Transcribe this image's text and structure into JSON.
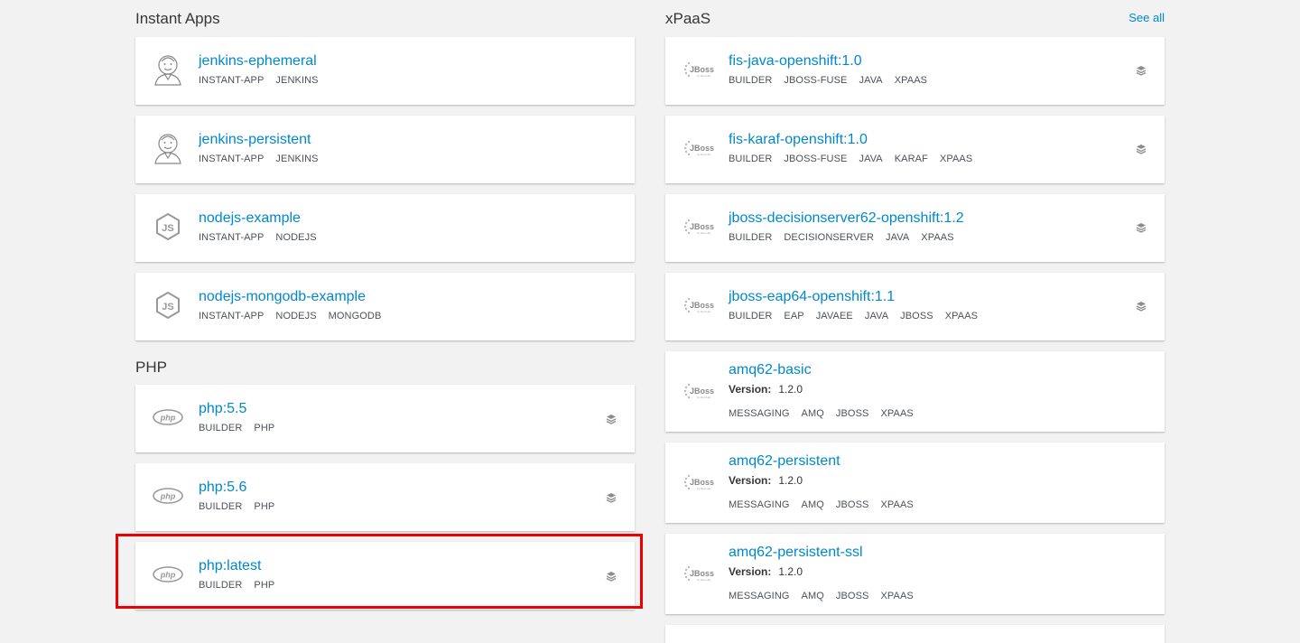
{
  "instant_apps": {
    "title": "Instant Apps",
    "items": [
      {
        "name": "jenkins-ephemeral",
        "icon": "jenkins-icon",
        "tags": [
          "INSTANT-APP",
          "JENKINS"
        ]
      },
      {
        "name": "jenkins-persistent",
        "icon": "jenkins-icon",
        "tags": [
          "INSTANT-APP",
          "JENKINS"
        ]
      },
      {
        "name": "nodejs-example",
        "icon": "nodejs-icon",
        "tags": [
          "INSTANT-APP",
          "NODEJS"
        ]
      },
      {
        "name": "nodejs-mongodb-example",
        "icon": "nodejs-icon",
        "tags": [
          "INSTANT-APP",
          "NODEJS",
          "MONGODB"
        ]
      }
    ]
  },
  "php": {
    "title": "PHP",
    "items": [
      {
        "name": "php:5.5",
        "icon": "php-icon",
        "tags": [
          "BUILDER",
          "PHP"
        ]
      },
      {
        "name": "php:5.6",
        "icon": "php-icon",
        "tags": [
          "BUILDER",
          "PHP"
        ]
      },
      {
        "name": "php:latest",
        "icon": "php-icon",
        "tags": [
          "BUILDER",
          "PHP"
        ]
      }
    ]
  },
  "xpaas": {
    "title": "xPaaS",
    "see_all": "See all",
    "items": [
      {
        "name": "fis-java-openshift:1.0",
        "tags": [
          "BUILDER",
          "JBOSS-FUSE",
          "JAVA",
          "XPAAS"
        ]
      },
      {
        "name": "fis-karaf-openshift:1.0",
        "tags": [
          "BUILDER",
          "JBOSS-FUSE",
          "JAVA",
          "KARAF",
          "XPAAS"
        ]
      },
      {
        "name": "jboss-decisionserver62-openshift:1.2",
        "tags": [
          "BUILDER",
          "DECISIONSERVER",
          "JAVA",
          "XPAAS"
        ]
      },
      {
        "name": "jboss-eap64-openshift:1.1",
        "tags": [
          "BUILDER",
          "EAP",
          "JAVAEE",
          "JAVA",
          "JBOSS",
          "XPAAS"
        ]
      },
      {
        "name": "amq62-basic",
        "version_label": "Version:",
        "version": "1.2.0",
        "tags": [
          "MESSAGING",
          "AMQ",
          "JBOSS",
          "XPAAS"
        ]
      },
      {
        "name": "amq62-persistent",
        "version_label": "Version:",
        "version": "1.2.0",
        "tags": [
          "MESSAGING",
          "AMQ",
          "JBOSS",
          "XPAAS"
        ]
      },
      {
        "name": "amq62-persistent-ssl",
        "version_label": "Version:",
        "version": "1.2.0",
        "tags": [
          "MESSAGING",
          "AMQ",
          "JBOSS",
          "XPAAS"
        ]
      }
    ]
  },
  "colors": {
    "link": "#0088ce",
    "highlight": "#e00000",
    "background": "#f2f2f2"
  }
}
